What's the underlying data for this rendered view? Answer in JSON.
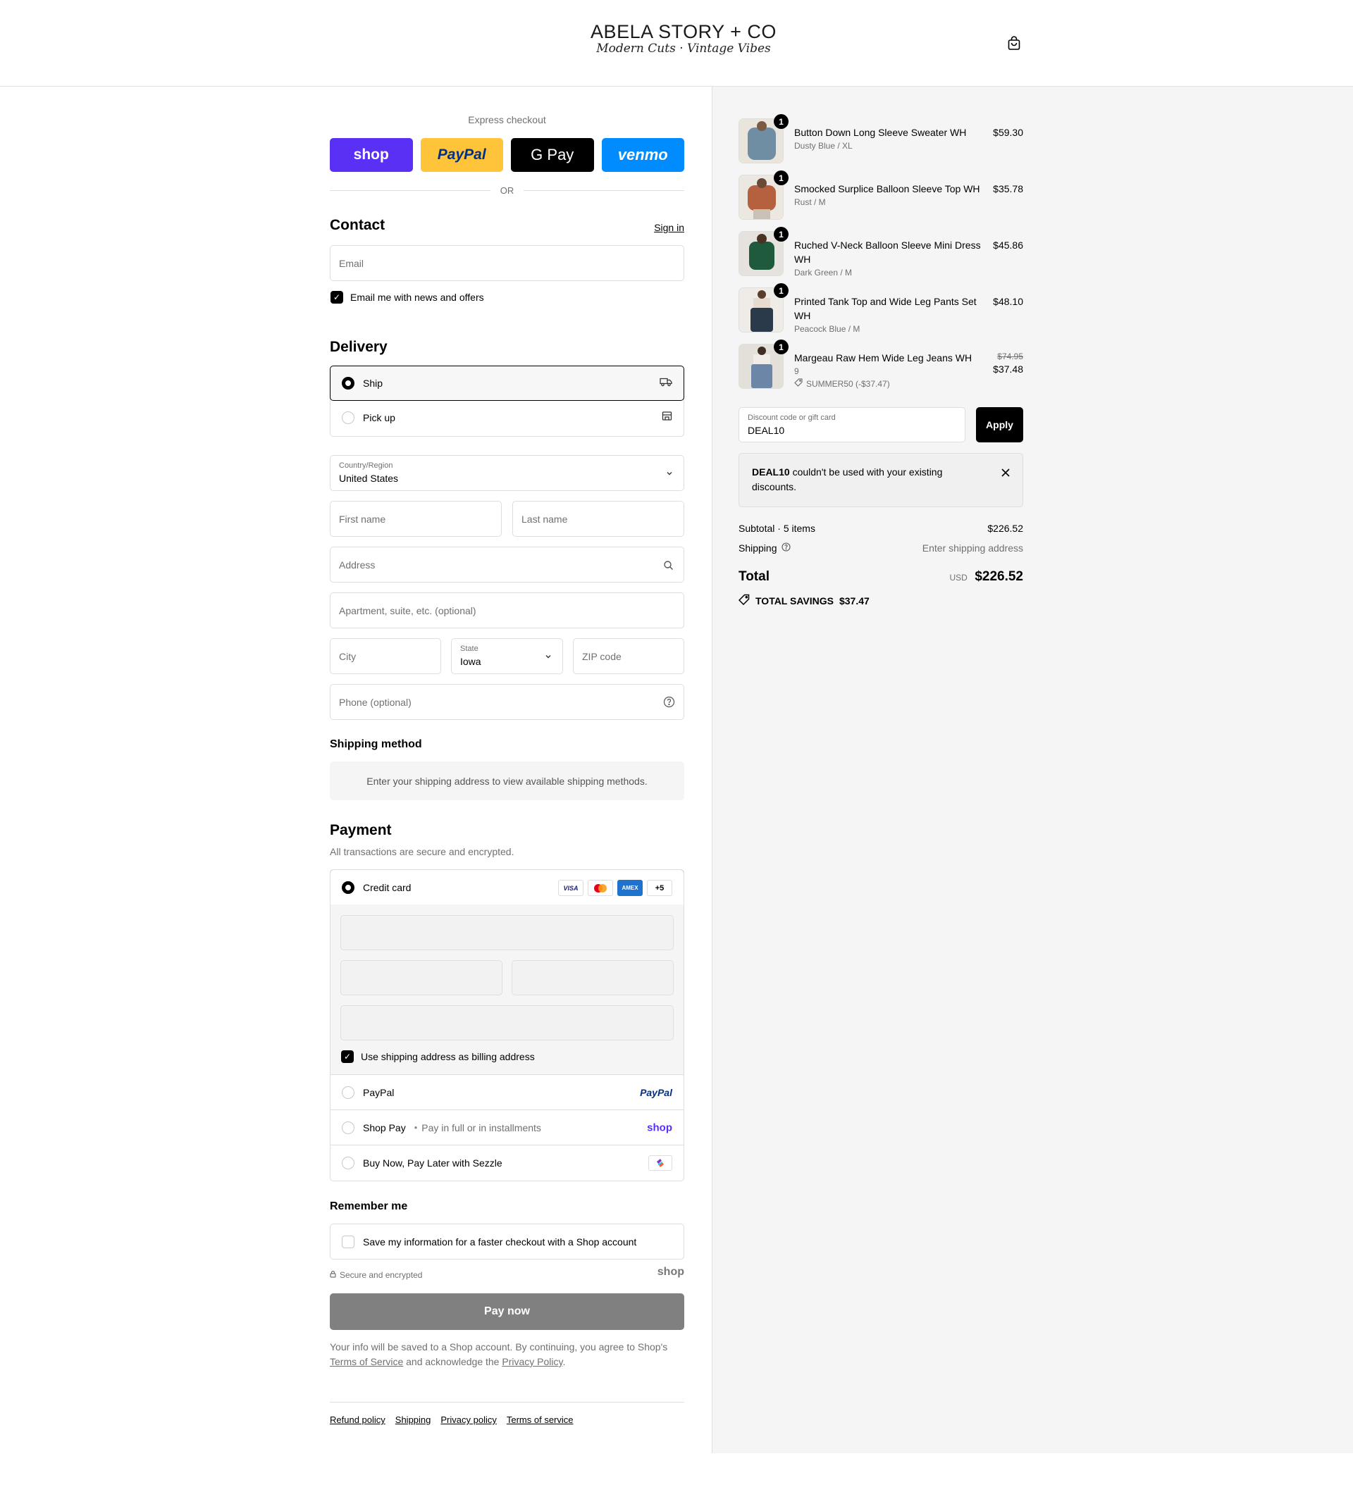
{
  "header": {
    "logo_main": "ABELA STORY + CO",
    "logo_sub": "Modern Cuts · Vintage Vibes"
  },
  "express": {
    "title": "Express checkout",
    "shop": "shop",
    "paypal": "PayPal",
    "gpay": "G Pay",
    "venmo": "venmo",
    "or": "OR"
  },
  "contact": {
    "title": "Contact",
    "sign_in": "Sign in",
    "email_placeholder": "Email",
    "news_label": "Email me with news and offers"
  },
  "delivery": {
    "title": "Delivery",
    "ship": "Ship",
    "pickup": "Pick up",
    "country_label": "Country/Region",
    "country_value": "United States",
    "first_name": "First name",
    "last_name": "Last name",
    "address": "Address",
    "apartment": "Apartment, suite, etc. (optional)",
    "city": "City",
    "state_label": "State",
    "state_value": "Iowa",
    "zip": "ZIP code",
    "phone": "Phone (optional)"
  },
  "shipping_method": {
    "title": "Shipping method",
    "notice": "Enter your shipping address to view available shipping methods."
  },
  "payment": {
    "title": "Payment",
    "subtitle": "All transactions are secure and encrypted.",
    "credit_card": "Credit card",
    "card_badges": [
      "VISA",
      "MC",
      "AMEX",
      "+5"
    ],
    "billing_label": "Use shipping address as billing address",
    "paypal": "PayPal",
    "paypal_logo": "PayPal",
    "shop_pay": "Shop Pay",
    "shop_pay_sub": "Pay in full or in installments",
    "shop_logo": "shop",
    "sezzle": "Buy Now, Pay Later with Sezzle"
  },
  "remember": {
    "title": "Remember me",
    "save_label": "Save my information for a faster checkout with a Shop account",
    "secure": "Secure and encrypted",
    "shop_logo": "shop"
  },
  "pay_button": "Pay now",
  "consent": {
    "pre": "Your info will be saved to a Shop account. By continuing, you agree to Shop's",
    "terms": "Terms of Service",
    "mid": "and acknowledge the",
    "privacy": "Privacy Policy",
    "end": "."
  },
  "footer": {
    "links": [
      "Refund policy",
      "Shipping",
      "Privacy policy",
      "Terms of service"
    ]
  },
  "cart": {
    "items": [
      {
        "qty": "1",
        "name": "Button Down Long Sleeve Sweater WH",
        "variant": "Dusty Blue / XL",
        "price": "$59.30",
        "color": "#6f8ea3"
      },
      {
        "qty": "1",
        "name": "Smocked Surplice Balloon Sleeve Top WH",
        "variant": "Rust / M",
        "price": "$35.78",
        "color": "#b5603f"
      },
      {
        "qty": "1",
        "name": "Ruched V-Neck Balloon Sleeve Mini Dress WH",
        "variant": "Dark Green / M",
        "price": "$45.86",
        "color": "#1f5a3d"
      },
      {
        "qty": "1",
        "name": "Printed Tank Top and Wide Leg Pants Set WH",
        "variant": "Peacock Blue / M",
        "price": "$48.10",
        "color": "#2a3a4a"
      },
      {
        "qty": "1",
        "name": "Margeau Raw Hem Wide Leg Jeans WH",
        "variant": "9",
        "discount": "SUMMER50 (-$37.47)",
        "price_old": "$74.95",
        "price": "$37.48",
        "color": "#6b86a6"
      }
    ],
    "discount_label": "Discount code or gift card",
    "discount_value": "DEAL10",
    "apply": "Apply",
    "error_code": "DEAL10",
    "error_text": "couldn't be used with your existing discounts.",
    "subtotal_label": "Subtotal · 5 items",
    "subtotal_value": "$226.52",
    "shipping_label": "Shipping",
    "shipping_value": "Enter shipping address",
    "total_label": "Total",
    "currency": "USD",
    "total_value": "$226.52",
    "savings_label": "TOTAL SAVINGS",
    "savings_value": "$37.47"
  }
}
